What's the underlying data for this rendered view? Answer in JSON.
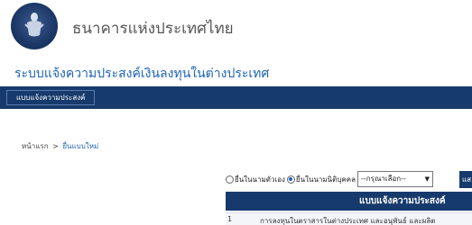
{
  "header": {
    "bank_name": "ธนาคารแห่งประเทศไทย",
    "logo": "bank-of-thailand-seal"
  },
  "system": {
    "title": "ระบบแจ้งความประสงค์เงินลงทุนในต่างประเทศ"
  },
  "nav": {
    "tab_label": "แบบแจ้งความประสงค์"
  },
  "breadcrumb": {
    "home": "หน้าแรก",
    "separator": ">",
    "current": "ยื่นแบบใหม่"
  },
  "filter": {
    "radio_individual_label": "ยื่นในนามตัวเอง",
    "radio_individual_checked": false,
    "radio_juristic_label": "ยื่นในนามนิติบุคคล",
    "radio_juristic_checked": true,
    "select_value": "--กรุณาเลือก--",
    "go_label": "แส"
  },
  "form_table": {
    "header": "แบบแจ้งความประสงค์",
    "rows": [
      {
        "number": "1",
        "text": "การลงทุนในตราสารในต่างประเทศ และอนุพันธ์ และผลิต"
      }
    ]
  },
  "colors": {
    "navy": "#173a6c",
    "link_blue": "#1d64b5"
  }
}
